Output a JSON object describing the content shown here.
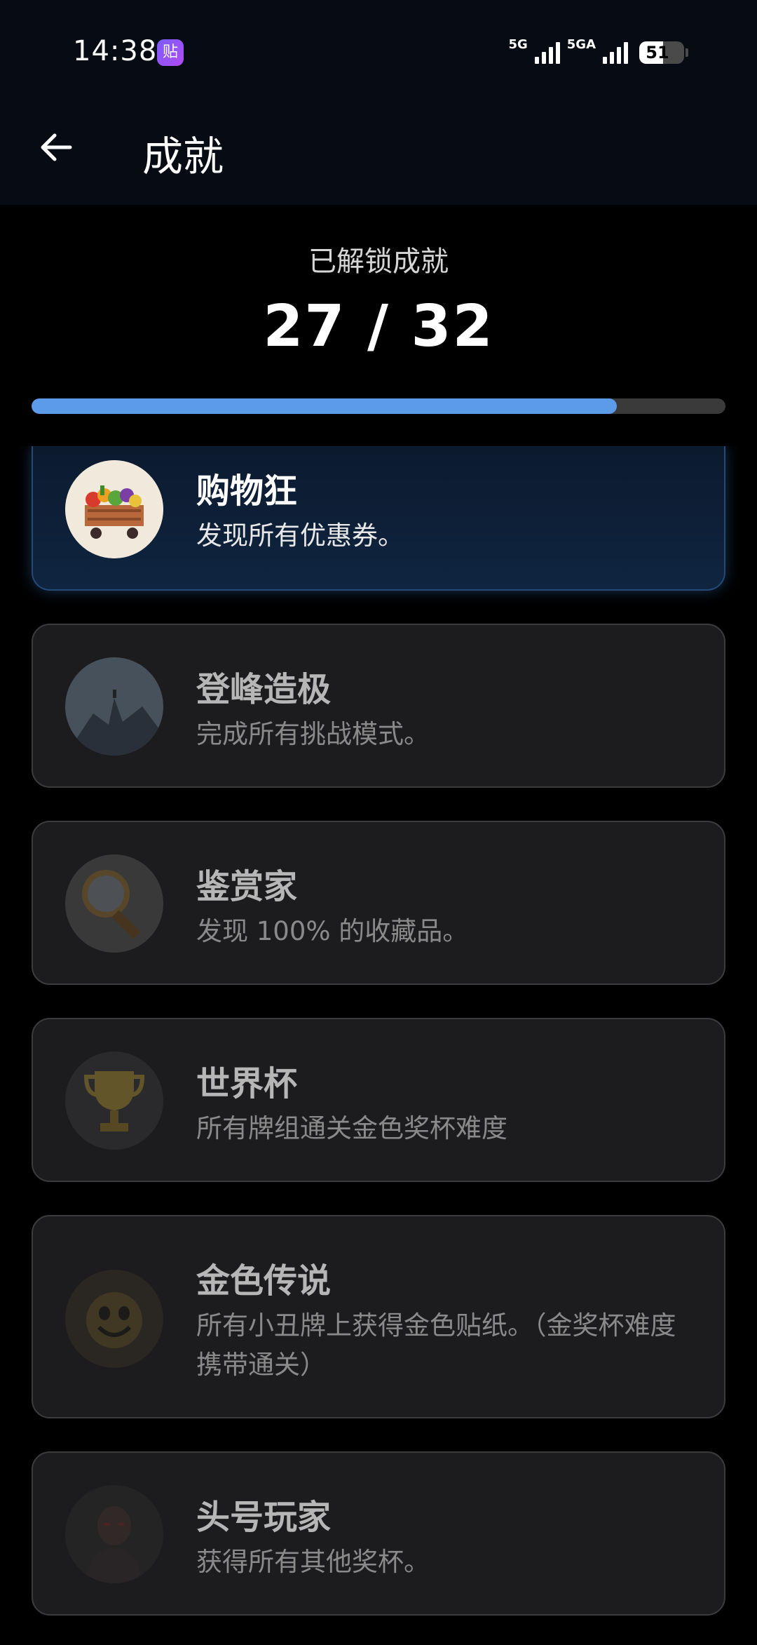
{
  "status_bar": {
    "time": "14:38",
    "app_icon_text": "贴",
    "net1": "5G",
    "net2": "5GA",
    "battery": "51"
  },
  "header": {
    "title": "成就"
  },
  "summary": {
    "label": "已解锁成就",
    "count": "27 / 32",
    "unlocked": 27,
    "total": 32
  },
  "achievements": [
    {
      "title": "购物狂",
      "desc": "发现所有优惠券。",
      "unlocked": true,
      "icon": "shopping-cart-icon"
    },
    {
      "title": "登峰造极",
      "desc": "完成所有挑战模式。",
      "unlocked": false,
      "icon": "mountain-peak-icon"
    },
    {
      "title": "鉴赏家",
      "desc": "发现 100% 的收藏品。",
      "unlocked": false,
      "icon": "magnifier-icon"
    },
    {
      "title": "世界杯",
      "desc": "所有牌组通关金色奖杯难度",
      "unlocked": false,
      "icon": "trophy-icon"
    },
    {
      "title": "金色传说",
      "desc": "所有小丑牌上获得金色贴纸。（金奖杯难度携带通关）",
      "unlocked": false,
      "icon": "golden-joker-icon"
    },
    {
      "title": "头号玩家",
      "desc": "获得所有其他奖杯。",
      "unlocked": false,
      "icon": "player-portrait-icon"
    }
  ],
  "colors": {
    "accent": "#5b9be8",
    "progress_track": "#3a3a3a",
    "card_bg": "#1c1c1e",
    "unlocked_card_bg": "#0f2540"
  }
}
